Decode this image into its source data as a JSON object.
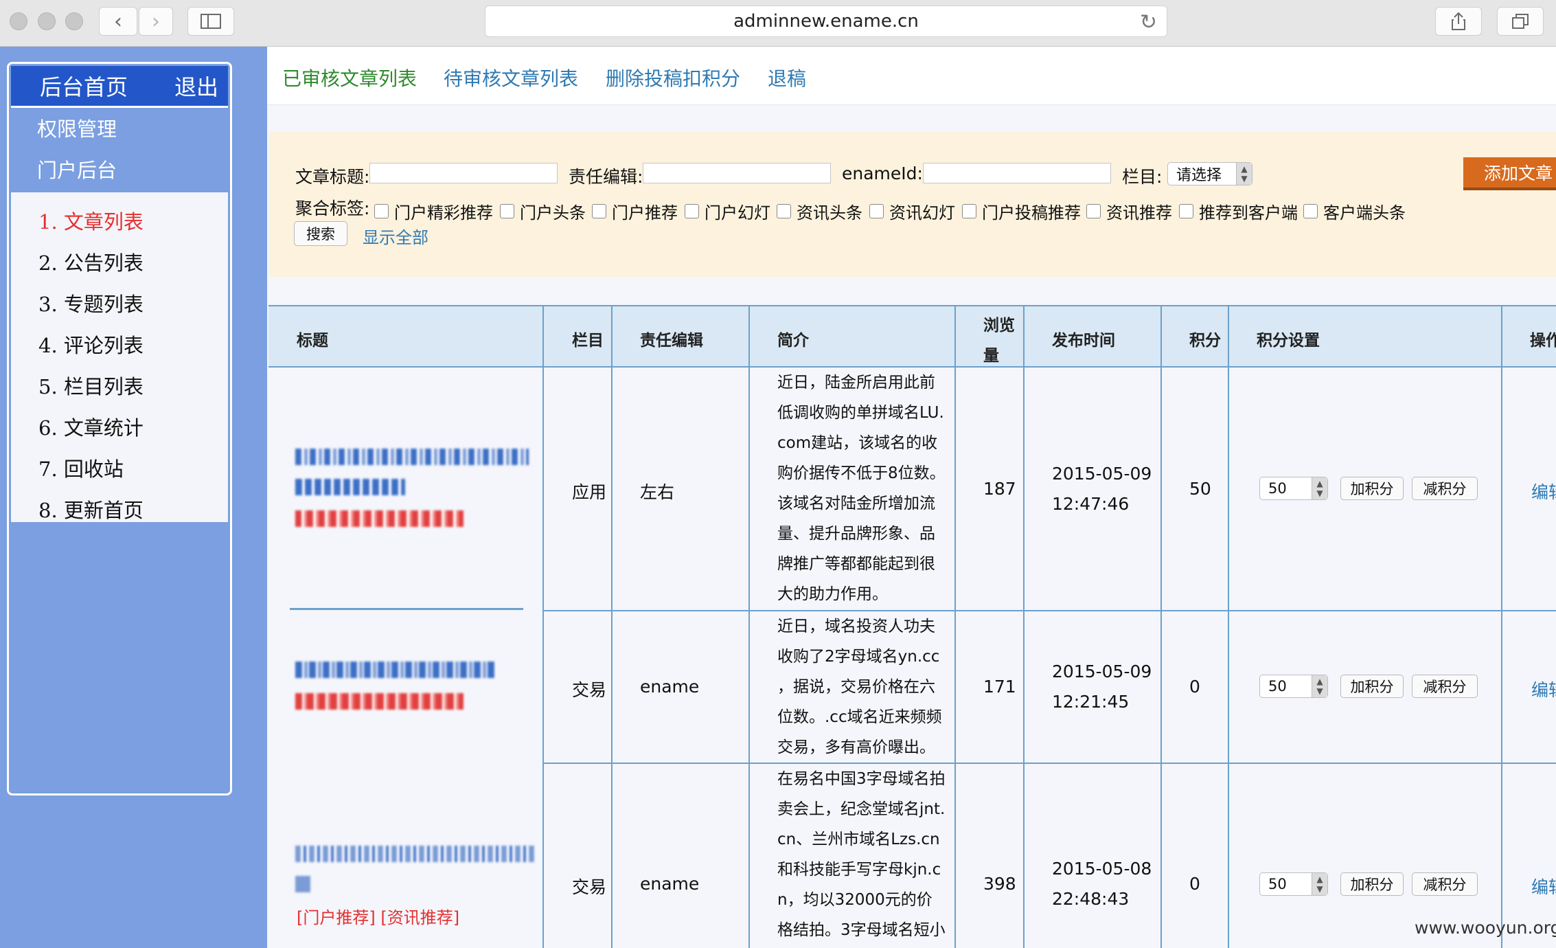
{
  "browser": {
    "url": "adminnew.ename.cn",
    "icons": [
      "back-icon",
      "forward-icon",
      "sidebar-icon",
      "reload-icon",
      "share-icon",
      "tabs-icon"
    ]
  },
  "sidebar": {
    "home": "后台首页",
    "logout": "退出",
    "section1": "权限管理",
    "section2": "门户后台",
    "items": [
      {
        "label": "1. 文章列表",
        "active": true
      },
      {
        "label": "2. 公告列表"
      },
      {
        "label": "3. 专题列表"
      },
      {
        "label": "4. 评论列表"
      },
      {
        "label": "5. 栏目列表"
      },
      {
        "label": "6. 文章统计"
      },
      {
        "label": "7. 回收站"
      },
      {
        "label": "8. 更新首页"
      }
    ]
  },
  "tabs": [
    "已审核文章列表",
    "待审核文章列表",
    "删除投稿扣积分",
    "退稿"
  ],
  "filters": {
    "title_label": "文章标题:",
    "editor_label": "责任编辑:",
    "enameid_label": "enameId:",
    "column_label": "栏目:",
    "column_value": "请选择",
    "tags_label": "聚合标签:",
    "tags": [
      "门户精彩推荐",
      "门户头条",
      "门户推荐",
      "门户幻灯",
      "资讯头条",
      "资讯幻灯",
      "门户投稿推荐",
      "资讯推荐",
      "推荐到客户端",
      "客户端头条"
    ],
    "search": "搜索",
    "show_all": "显示全部",
    "add_article": "添加文章"
  },
  "table": {
    "headers": {
      "title": "标题",
      "column": "栏目",
      "editor": "责任编辑",
      "intro": "简介",
      "views_1": "浏览",
      "views_2": "量",
      "time": "发布时间",
      "points": "积分",
      "points_setting": "积分设置",
      "ops": "操作"
    },
    "rows": [
      {
        "column": "应用",
        "editor": "左右",
        "intro": "近日，陆金所启用此前\n低调收购的单拼域名LU.\ncom建站，该域名的收\n购价据传不低于8位数。\n该域名对陆金所增加流\n量、提升品牌形象、品\n牌推广等都都能起到很\n大的助力作用。",
        "views": "187",
        "date": "2015-05-09",
        "time": "12:47:46",
        "points": "50",
        "points_select": "50",
        "op": "编辑"
      },
      {
        "column": "交易",
        "editor": "ename",
        "intro": "近日，域名投资人功夫\n收购了2字母域名yn.cc\n，据说，交易价格在六\n位数。.cc域名近来频频\n交易，多有高价曝出。",
        "views": "171",
        "date": "2015-05-09",
        "time": "12:21:45",
        "points": "0",
        "points_select": "50",
        "op": "编辑"
      },
      {
        "tags": "[门户推荐] [资讯推荐]",
        "column": "交易",
        "editor": "ename",
        "intro": "在易名中国3字母域名拍\n卖会上，纪念堂域名jnt.\ncn、兰州市域名Lzs.cn\n和科技能手写字母kjn.c\nn，均以32000元的价\n格结拍。3字母域名短小",
        "views": "398",
        "date": "2015-05-08",
        "time": "22:48:43",
        "points": "0",
        "points_select": "50",
        "op": "编辑"
      }
    ],
    "add_points": "加积分",
    "sub_points": "减积分"
  },
  "watermark": "www.wooyun.org"
}
